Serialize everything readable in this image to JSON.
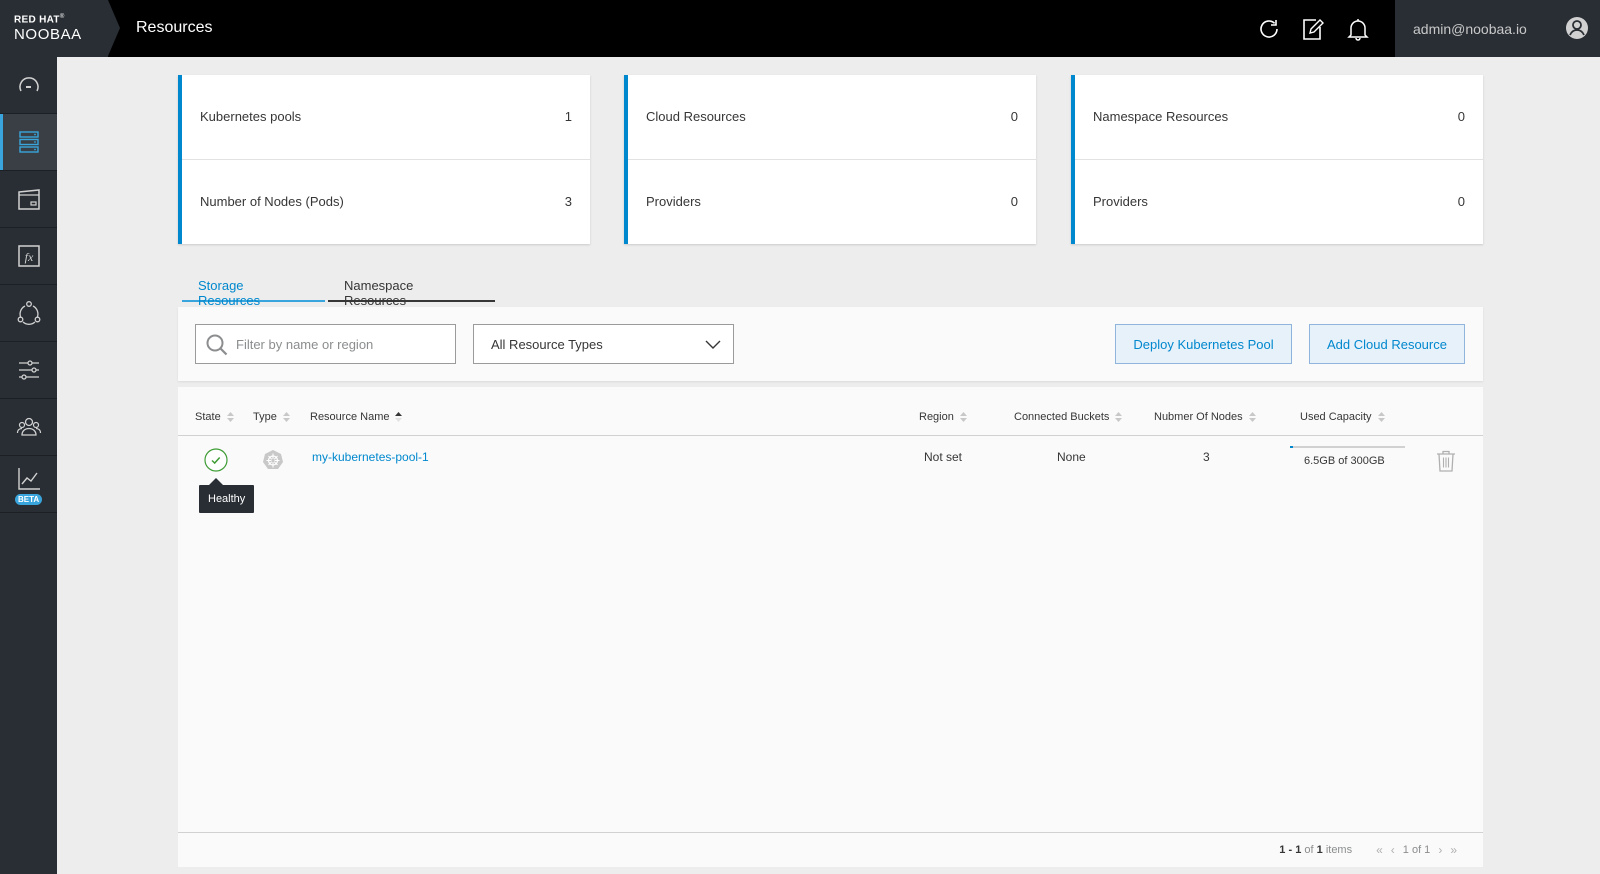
{
  "header": {
    "brand_top": "RED HAT",
    "brand_name": "NOOBAA",
    "page_title": "Resources",
    "user_email": "admin@noobaa.io",
    "icons": [
      "refresh-icon",
      "edit-icon",
      "bell-icon",
      "user-avatar-icon"
    ]
  },
  "sidebar": {
    "items": [
      {
        "icon": "dashboard-gauge-icon",
        "active": false
      },
      {
        "icon": "resources-server-icon",
        "active": true
      },
      {
        "icon": "buckets-icon",
        "active": false
      },
      {
        "icon": "functions-fx-icon",
        "active": false
      },
      {
        "icon": "cluster-icon",
        "active": false
      },
      {
        "icon": "settings-sliders-icon",
        "active": false
      },
      {
        "icon": "accounts-users-icon",
        "active": false
      },
      {
        "icon": "analytics-chart-icon",
        "active": false,
        "badge": "BETA"
      }
    ]
  },
  "summary_cards": [
    {
      "rows": [
        {
          "label": "Kubernetes pools",
          "value": "1"
        },
        {
          "label": "Number of Nodes (Pods)",
          "value": "3"
        }
      ]
    },
    {
      "rows": [
        {
          "label": "Cloud Resources",
          "value": "0"
        },
        {
          "label": "Providers",
          "value": "0"
        }
      ]
    },
    {
      "rows": [
        {
          "label": "Namespace Resources",
          "value": "0"
        },
        {
          "label": "Providers",
          "value": "0"
        }
      ]
    }
  ],
  "tabs": [
    {
      "label": "Storage Resources",
      "active": true
    },
    {
      "label": "Namespace Resources",
      "active": false
    }
  ],
  "toolbar": {
    "search_placeholder": "Filter by name or region",
    "search_value": "",
    "type_filter_value": "All Resource Types",
    "deploy_button": "Deploy Kubernetes Pool",
    "add_cloud_button": "Add Cloud Resource"
  },
  "table": {
    "columns": [
      "State",
      "Type",
      "Resource Name",
      "Region",
      "Connected Buckets",
      "Nubmer Of Nodes",
      "Used Capacity"
    ],
    "sorted_column": "Resource Name",
    "rows": [
      {
        "state": "Healthy",
        "type": "kubernetes",
        "name": "my-kubernetes-pool-1",
        "region": "Not set",
        "connected_buckets": "None",
        "nodes": "3",
        "used_capacity_text": "6.5GB of 300GB",
        "used_capacity_fraction": 0.022
      }
    ],
    "tooltip": "Healthy"
  },
  "pagination": {
    "range": "1 - 1",
    "of_label": "of",
    "total": "1",
    "items_label": "items",
    "page_text": "1 of 1"
  },
  "colors": {
    "accent": "#0088ce",
    "healthy": "#3f9c35",
    "header_bg": "#000000",
    "sidebar_bg": "#292e34"
  }
}
